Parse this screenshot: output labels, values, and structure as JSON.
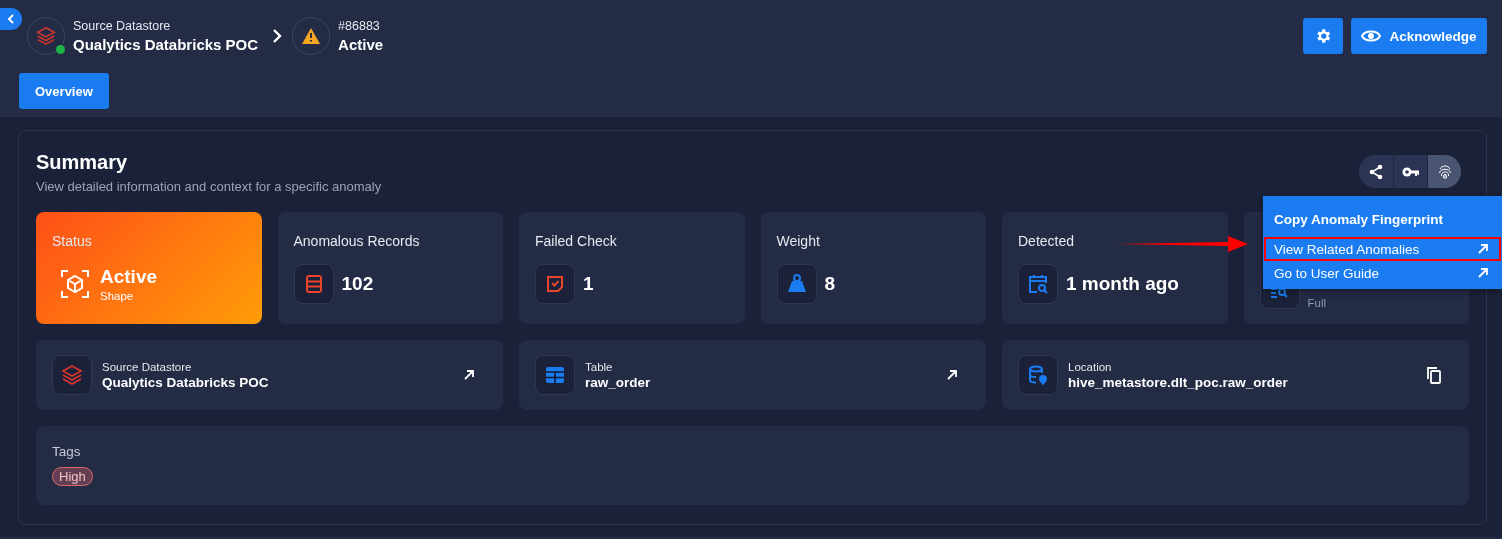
{
  "breadcrumb": {
    "source": {
      "label": "Source Datastore",
      "name": "Qualytics Databricks POC",
      "online": true
    },
    "anomaly": {
      "id": "#86883",
      "status": "Active"
    }
  },
  "header_actions": {
    "acknowledge": "Acknowledge"
  },
  "tabs": [
    {
      "label": "Overview",
      "selected": true
    }
  ],
  "summary": {
    "title": "Summary",
    "subtitle": "View detailed information and context for a specific anomaly",
    "toolbar": [
      {
        "kind": "share",
        "selected": false
      },
      {
        "kind": "key",
        "selected": false
      },
      {
        "kind": "fingerprint",
        "selected": true
      }
    ],
    "stats": [
      {
        "kind": "status",
        "label": "Status",
        "value": "Active",
        "sub": "Shape"
      },
      {
        "kind": "metric",
        "label": "Anomalous Records",
        "value": "102"
      },
      {
        "kind": "metric",
        "label": "Failed Check",
        "value": "1"
      },
      {
        "kind": "metric",
        "label": "Weight",
        "value": "8"
      },
      {
        "kind": "metric",
        "label": "Detected",
        "value": "1 month ago"
      },
      {
        "kind": "covered",
        "sub": "Full"
      }
    ],
    "details": [
      {
        "label": "Source Datastore",
        "value": "Qualytics Databricks POC",
        "kind": "open"
      },
      {
        "label": "Table",
        "value": "raw_order",
        "kind": "open"
      },
      {
        "label": "Location",
        "value": "hive_metastore.dlt_poc.raw_order",
        "kind": "copy"
      }
    ],
    "tags": {
      "label": "Tags",
      "items": [
        {
          "label": "High",
          "color": "#e0686b"
        }
      ]
    }
  },
  "menu": [
    {
      "label": "Copy Anomaly Fingerprint",
      "kind": "title",
      "highlighted": false
    },
    {
      "label": "View Related Anomalies",
      "kind": "link",
      "highlighted": true
    },
    {
      "label": "Go to User Guide",
      "kind": "link",
      "highlighted": false
    }
  ]
}
